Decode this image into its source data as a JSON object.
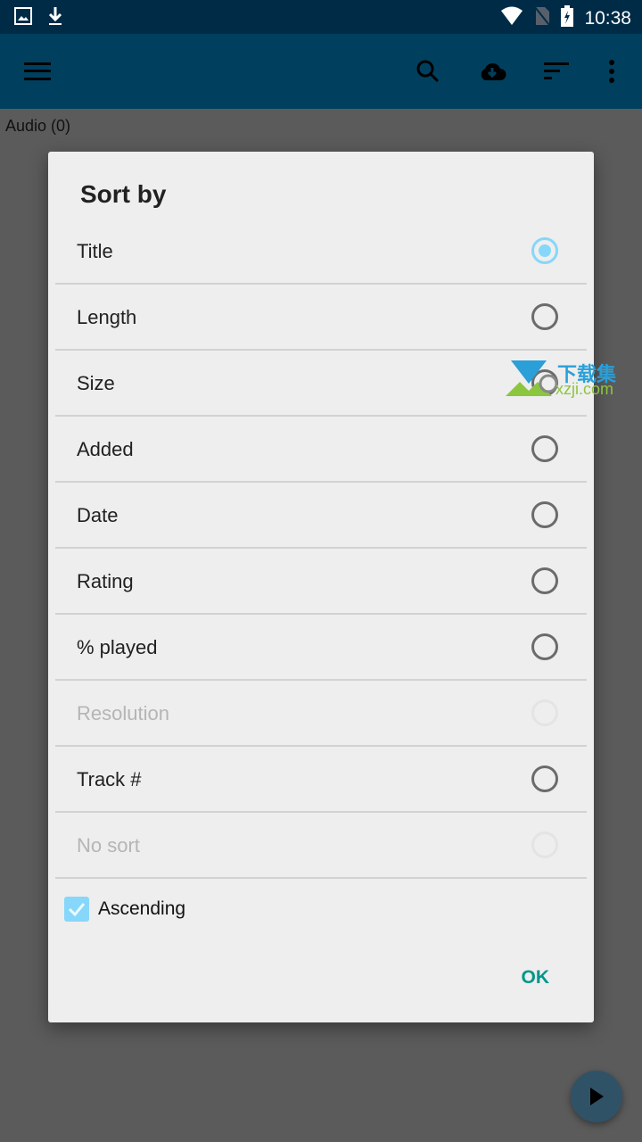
{
  "status_bar": {
    "time": "10:38",
    "left_icons": [
      "image-icon",
      "download-icon"
    ],
    "right_icons": [
      "wifi-icon",
      "no-sim-icon",
      "battery-charging-icon"
    ]
  },
  "app_bar": {
    "icons": [
      "menu-icon",
      "search-icon",
      "cloud-download-icon",
      "sort-icon",
      "more-vert-icon"
    ]
  },
  "subheader": {
    "label": "Audio (0)"
  },
  "dialog": {
    "title": "Sort by",
    "options": [
      {
        "label": "Title",
        "state": "selected"
      },
      {
        "label": "Length",
        "state": "enabled"
      },
      {
        "label": "Size",
        "state": "enabled"
      },
      {
        "label": "Added",
        "state": "enabled"
      },
      {
        "label": "Date",
        "state": "enabled"
      },
      {
        "label": "Rating",
        "state": "enabled"
      },
      {
        "label": "% played",
        "state": "enabled"
      },
      {
        "label": "Resolution",
        "state": "disabled"
      },
      {
        "label": "Track #",
        "state": "enabled"
      },
      {
        "label": "No sort",
        "state": "disabled"
      }
    ],
    "ascending_label": "Ascending",
    "ascending_checked": true,
    "ok_label": "OK"
  },
  "watermark": {
    "cn": "下载集",
    "en": "xzji.com"
  },
  "colors": {
    "status_bar": "#002b47",
    "app_bar": "#00405e",
    "accent": "#86d7f9",
    "ok": "#00968a"
  }
}
